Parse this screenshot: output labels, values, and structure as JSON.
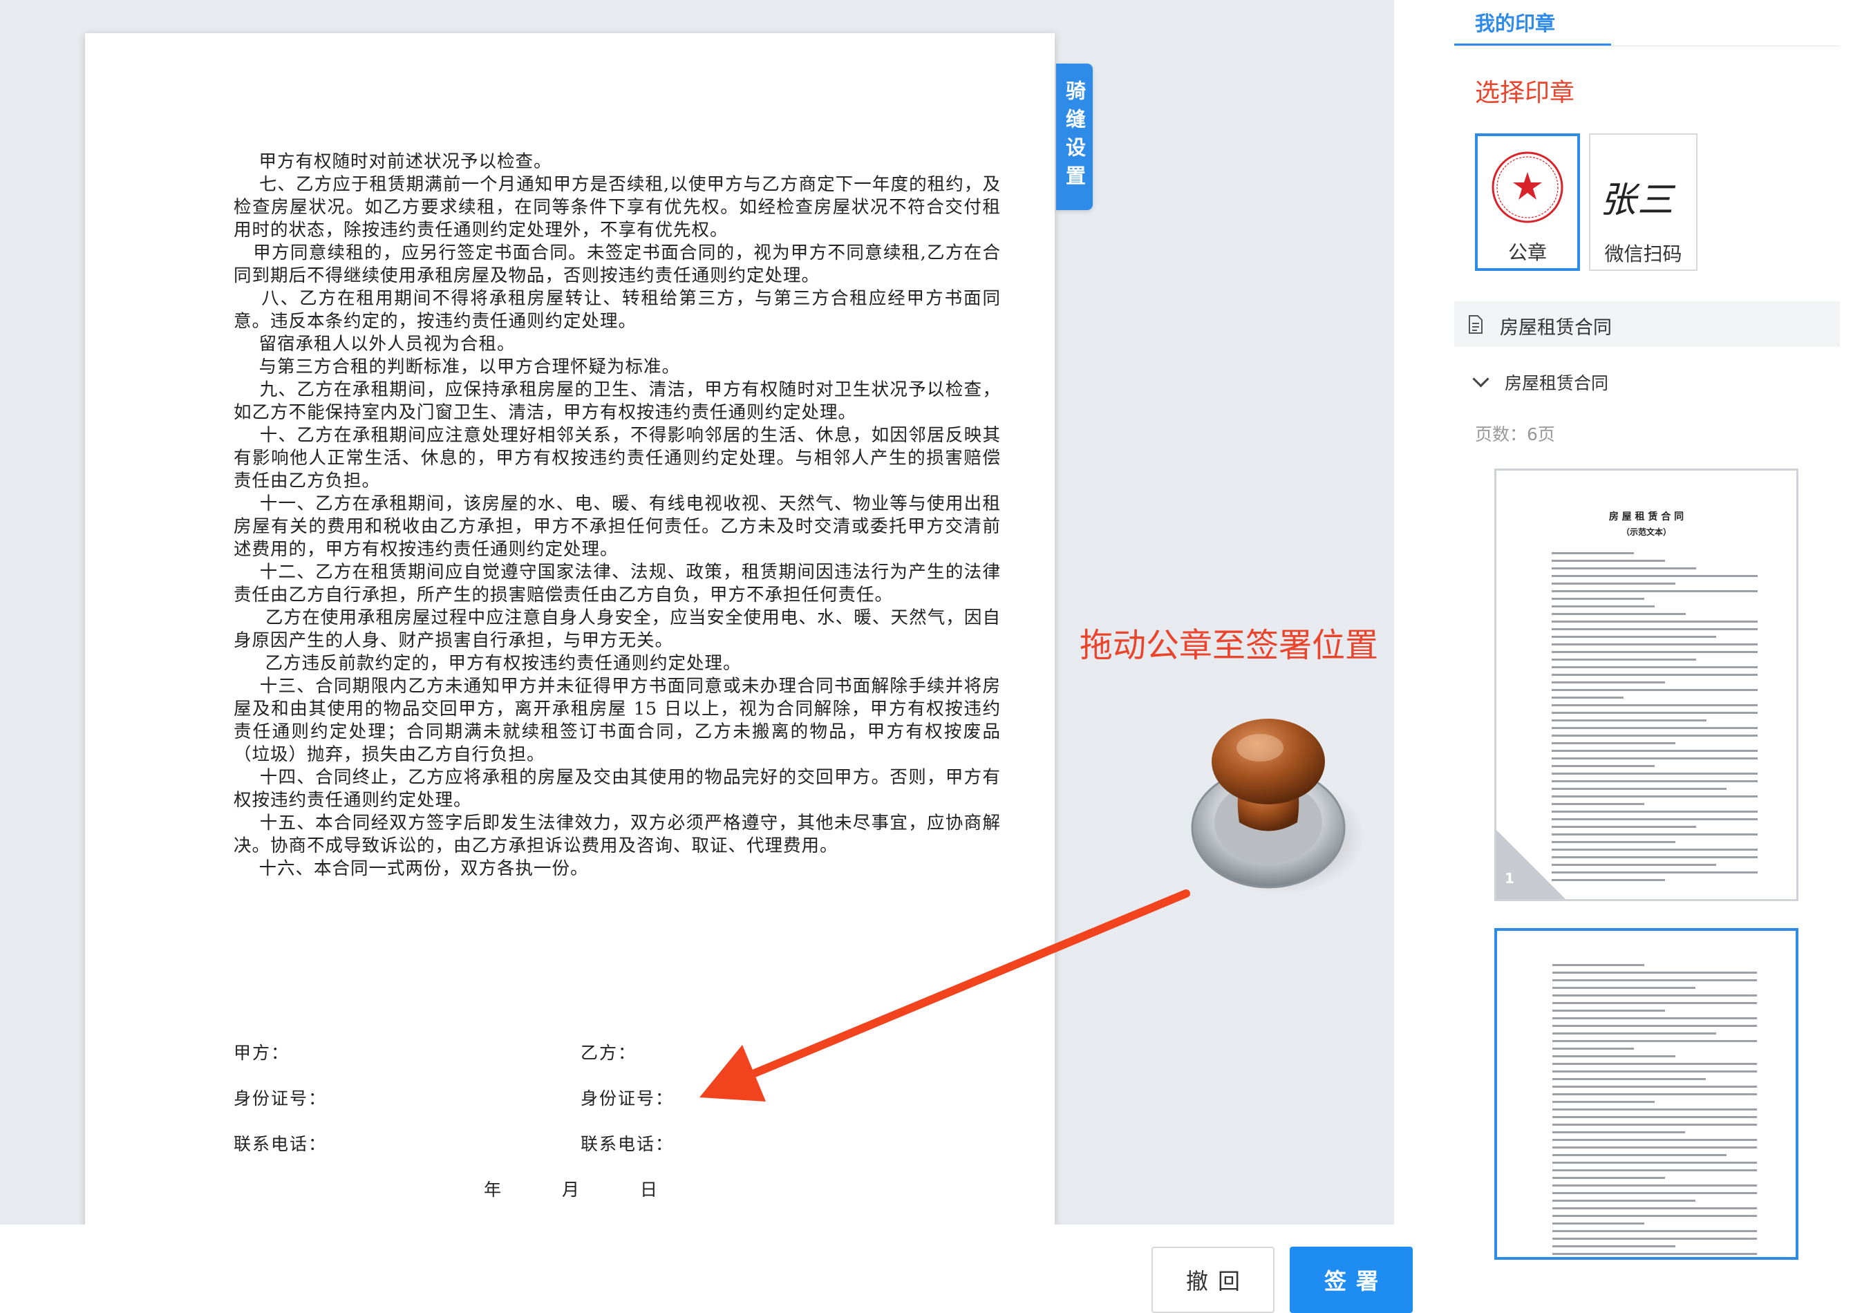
{
  "document": {
    "paragraphs": [
      "    甲方有权随时对前述状况予以检查。",
      "    七、乙方应于租赁期满前一个月通知甲方是否续租,以使甲方与乙方商定下一年度的租约，及检查房屋状况。如乙方要求续租，在同等条件下享有优先权。如经检查房屋状况不符合交付租用时的状态，除按违约责任通则约定处理外，不享有优先权。",
      "   甲方同意续租的，应另行签定书面合同。未签定书面合同的，视为甲方不同意续租,乙方在合同到期后不得继续使用承租房屋及物品，否则按违约责任通则约定处理。",
      "    八、乙方在租用期间不得将承租房屋转让、转租给第三方，与第三方合租应经甲方书面同意。违反本条约定的，按违约责任通则约定处理。",
      "    留宿承租人以外人员视为合租。",
      "    与第三方合租的判断标准，以甲方合理怀疑为标准。",
      "    九、乙方在承租期间，应保持承租房屋的卫生、清洁，甲方有权随时对卫生状况予以检查，如乙方不能保持室内及门窗卫生、清洁，甲方有权按违约责任通则约定处理。",
      "    十、乙方在承租期间应注意处理好相邻关系，不得影响邻居的生活、休息，如因邻居反映其有影响他人正常生活、休息的，甲方有权按违约责任通则约定处理。与相邻人产生的损害赔偿责任由乙方负担。",
      "    十一、乙方在承租期间，该房屋的水、电、暖、有线电视收视、天然气、物业等与使用出租房屋有关的费用和税收由乙方承担，甲方不承担任何责任。乙方未及时交清或委托甲方交清前述费用的，甲方有权按违约责任通则约定处理。",
      "    十二、乙方在租赁期间应自觉遵守国家法律、法规、政策，租赁期间因违法行为产生的法律责任由乙方自行承担，所产生的损害赔偿责任由乙方自负，甲方不承担任何责任。",
      "     乙方在使用承租房屋过程中应注意自身人身安全，应当安全使用电、水、暖、天然气，因自身原因产生的人身、财产损害自行承担，与甲方无关。",
      "     乙方违反前款约定的，甲方有权按违约责任通则约定处理。",
      "    十三、合同期限内乙方未通知甲方并未征得甲方书面同意或未办理合同书面解除手续并将房屋及和由其使用的物品交回甲方，离开承租房屋 15 日以上，视为合同解除，甲方有权按违约责任通则约定处理；合同期满未就续租签订书面合同，乙方未搬离的物品，甲方有权按废品（垃圾）抛弃，损失由乙方自行负担。",
      "    十四、合同终止，乙方应将承租的房屋及交由其使用的物品完好的交回甲方。否则，甲方有权按违约责任通则约定处理。",
      "    十五、本合同经双方签字后即发生法律效力，双方必须严格遵守，其他未尽事宜，应协商解决。协商不成导致诉讼的，由乙方承担诉讼费用及咨询、取证、代理费用。",
      "    十六、本合同一式两份，双方各执一份。"
    ],
    "sign": {
      "party_a": "甲方：",
      "party_b": "乙方：",
      "id_a": "身份证号：",
      "id_b": "身份证号：",
      "phone_a": "联系电话：",
      "phone_b": "联系电话：",
      "year": "年",
      "month": "月",
      "day": "日"
    }
  },
  "seam_tab": "骑缝设置",
  "drag_hint": "拖动公章至签署位置",
  "panel": {
    "tab": "我的印章",
    "choose_title": "选择印章",
    "seals": [
      {
        "label": "公章",
        "selected": true
      },
      {
        "label": "微信扫码",
        "selected": false,
        "signature_text": "张三"
      }
    ],
    "doc_group": "房屋租赁合同",
    "doc_item": "房屋租赁合同",
    "pages": "页数：6页",
    "thumb1": {
      "title": "房 屋 租 赁 合 同",
      "subtitle": "（示范文本）",
      "page": "1"
    }
  },
  "footer": {
    "undo": "撤回",
    "sign": "签署"
  },
  "colors": {
    "accent_blue": "#2f8be8",
    "hint_red": "#e8452c"
  }
}
